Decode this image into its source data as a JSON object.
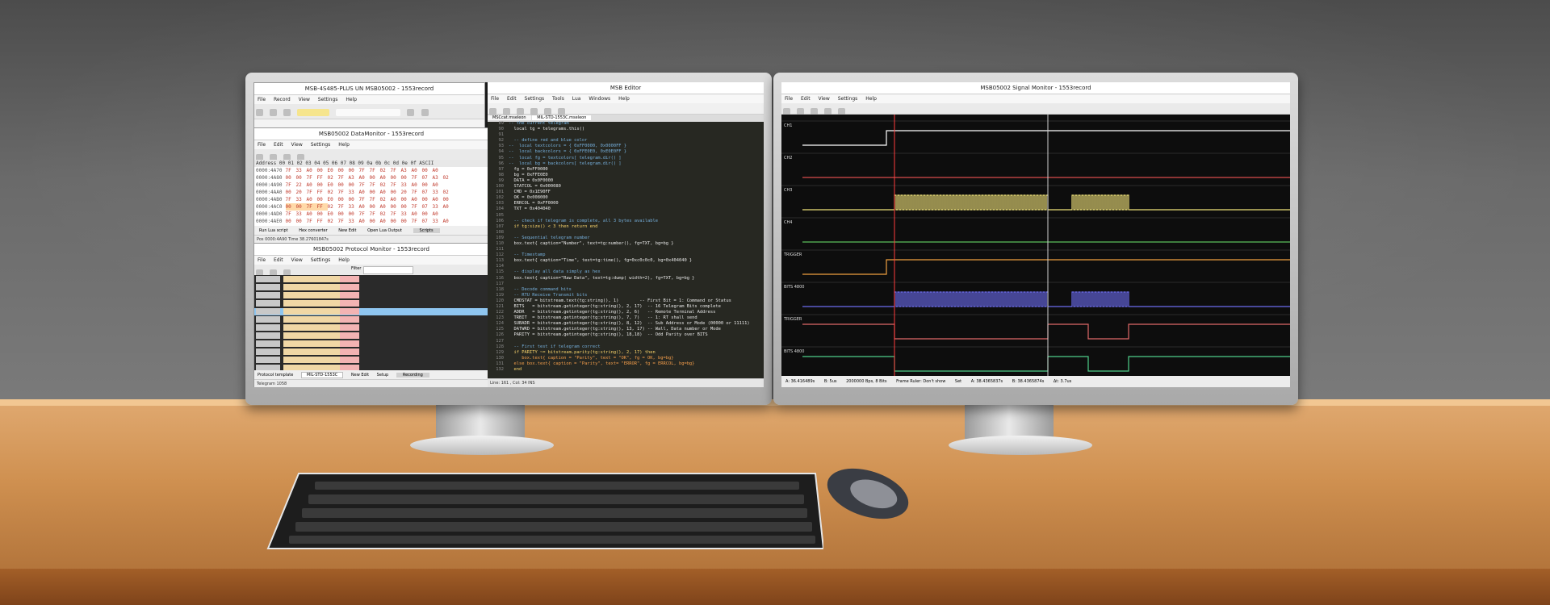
{
  "scene": {
    "wall_color": "#5f5f5f",
    "desk_color": "#d49a5d"
  },
  "left_monitor": {
    "proto_window": {
      "title": "MSB-4S485-PLUS UN MSB05002 - 1553record",
      "menu": [
        "File",
        "Record",
        "View",
        "Settings",
        "Help"
      ]
    },
    "data_window": {
      "title": "MSB05002 DataMonitor - 1553record",
      "menu": [
        "File",
        "Edit",
        "View",
        "Settings",
        "Help"
      ],
      "header": "Address  00 01 02 03 04 05 06 07 08 09 0a 0b 0c 0d 0e 0f ASCII",
      "rows": [
        {
          "addr": "0000:4A70",
          "vals": [
            "7F",
            "33",
            "A0",
            "00",
            "E0",
            "00",
            "00",
            "7F",
            "7F",
            "02",
            "7F",
            "A3",
            "A0",
            "00",
            "A0"
          ]
        },
        {
          "addr": "0000:4A80",
          "vals": [
            "00",
            "00",
            "7F",
            "FF",
            "02",
            "7F",
            "A3",
            "A0",
            "00",
            "A0",
            "00",
            "00",
            "7F",
            "07",
            "A3",
            "02"
          ]
        },
        {
          "addr": "0000:4A90",
          "vals": [
            "7F",
            "22",
            "A0",
            "00",
            "E0",
            "00",
            "00",
            "7F",
            "7F",
            "02",
            "7F",
            "33",
            "A0",
            "00",
            "A0"
          ]
        },
        {
          "addr": "0000:4AA0",
          "vals": [
            "00",
            "20",
            "7F",
            "FF",
            "02",
            "7F",
            "33",
            "A0",
            "00",
            "A0",
            "00",
            "20",
            "7F",
            "07",
            "33",
            "02"
          ]
        },
        {
          "addr": "0000:4AB0",
          "vals": [
            "7F",
            "33",
            "A0",
            "00",
            "E0",
            "00",
            "00",
            "7F",
            "7F",
            "02",
            "A0",
            "00",
            "A0",
            "00",
            "A0",
            "00"
          ]
        },
        {
          "addr": "0000:4AC0",
          "vals": [
            "00",
            "00",
            "7F",
            "FF",
            "02",
            "7F",
            "33",
            "A0",
            "00",
            "A0",
            "00",
            "00",
            "7F",
            "07",
            "33",
            "A0"
          ]
        },
        {
          "addr": "0000:4AD0",
          "vals": [
            "7F",
            "33",
            "A0",
            "00",
            "E0",
            "00",
            "00",
            "7F",
            "7F",
            "02",
            "7F",
            "33",
            "A0",
            "00",
            "A0"
          ]
        },
        {
          "addr": "0000:4AE0",
          "vals": [
            "00",
            "00",
            "7F",
            "FF",
            "02",
            "7F",
            "33",
            "A0",
            "00",
            "A0",
            "00",
            "00",
            "7F",
            "07",
            "33",
            "A0"
          ]
        }
      ],
      "buttons": [
        "Run Lua script",
        "Hex converter",
        "New Edit",
        "Open Lua Output",
        "Scripts"
      ],
      "status": "Pos 0000:4A90 Time 38.27601847s"
    },
    "protocol_window": {
      "title": "MSB05002 Protocol Monitor - 1553record",
      "menu": [
        "File",
        "Edit",
        "View",
        "Settings",
        "Help"
      ],
      "filter_label": "Filter",
      "bottom_label": "Protocol template",
      "template": "MIL-STD-1553C",
      "buttons": [
        "New Edit",
        "Setup",
        "Recording"
      ],
      "status": "Telegram 1058"
    },
    "editor": {
      "title": "MSB Editor",
      "menu": [
        "File",
        "Edit",
        "Settings",
        "Tools",
        "Lua",
        "Windows",
        "Help"
      ],
      "tabs": [
        "MSCcat.mseleon",
        "MIL-STD-1553C.mseleon"
      ],
      "lines": [
        {
          "n": "89",
          "t": "-- the current telegram",
          "c": "cm"
        },
        {
          "n": "90",
          "t": "  local tg = telegrams.this()",
          "c": ""
        },
        {
          "n": "91",
          "t": "",
          "c": ""
        },
        {
          "n": "92",
          "t": "  -- define red and blue color",
          "c": "cm"
        },
        {
          "n": "93",
          "t": "--  local textcolors = { 0xFF0000, 0x0000FF }",
          "c": "cm"
        },
        {
          "n": "94",
          "t": "--  local backcolors = { 0xFFE0E0, 0xE0E0FF }",
          "c": "cm"
        },
        {
          "n": "95",
          "t": "--  local fg = textcolors[ telegram.dir() ]",
          "c": "cm"
        },
        {
          "n": "96",
          "t": "--  local bg = backcolors[ telegram.dir() ]",
          "c": "cm"
        },
        {
          "n": "97",
          "t": "  fg = 0xFF0000",
          "c": ""
        },
        {
          "n": "98",
          "t": "  bg = 0xFFE0E0",
          "c": ""
        },
        {
          "n": "99",
          "t": "  DATA = 0x0F0000",
          "c": ""
        },
        {
          "n": "100",
          "t": "  STATCOL = 0x000080",
          "c": ""
        },
        {
          "n": "101",
          "t": "  CMD = 0x1E90FF",
          "c": ""
        },
        {
          "n": "102",
          "t": "  OK = 0x008000",
          "c": ""
        },
        {
          "n": "103",
          "t": "  ERRCOL = 0xFF0000",
          "c": ""
        },
        {
          "n": "104",
          "t": "  TXT = 0x404040",
          "c": ""
        },
        {
          "n": "105",
          "t": "",
          "c": ""
        },
        {
          "n": "106",
          "t": "  -- check if telegram is complete, all 3 bytes available",
          "c": "cm"
        },
        {
          "n": "107",
          "t": "  if tg:size() < 3 then return end",
          "c": "kw"
        },
        {
          "n": "108",
          "t": "",
          "c": ""
        },
        {
          "n": "109",
          "t": "  -- Sequential telegram number",
          "c": "cm"
        },
        {
          "n": "110",
          "t": "  box.text{ caption=\"Number\", text=tg:number(), fg=TXT, bg=bg }",
          "c": ""
        },
        {
          "n": "111",
          "t": "",
          "c": ""
        },
        {
          "n": "112",
          "t": "  -- Timestamp",
          "c": "cm"
        },
        {
          "n": "113",
          "t": "  box.text{ caption=\"Time\", text=tg:time(), fg=0xc0c0c0, bg=0x404040 }",
          "c": ""
        },
        {
          "n": "114",
          "t": "",
          "c": ""
        },
        {
          "n": "115",
          "t": "  -- display all data simply as hex",
          "c": "cm"
        },
        {
          "n": "116",
          "t": "  box.text{ caption=\"Raw Data\", text=tg:dump( width=2), fg=TXT, bg=bg }",
          "c": ""
        },
        {
          "n": "117",
          "t": "",
          "c": ""
        },
        {
          "n": "118",
          "t": "  -- Decode command bits",
          "c": "cm"
        },
        {
          "n": "119",
          "t": "  -- RTU Receive Transmit bits",
          "c": "cm"
        },
        {
          "n": "120",
          "t": "  CMDSTAT = bitstream.text(tg:string(), 1)        -- First Bit = 1: Command or Status",
          "c": ""
        },
        {
          "n": "121",
          "t": "  BITS   = bitstream.getinteger(tg:string(), 2, 17)  -- 16 Telegram Bits complete",
          "c": ""
        },
        {
          "n": "122",
          "t": "  ADDR   = bitstream.getinteger(tg:string(), 2, 6)   -- Remote Terminal Address",
          "c": ""
        },
        {
          "n": "123",
          "t": "  TRBIT  = bitstream.getinteger(tg:string(), 7, 7)   -- 1: RT shall send",
          "c": ""
        },
        {
          "n": "124",
          "t": "  SUBADR = bitstream.getinteger(tg:string(), 8, 12)  -- Sub Address or Mode (00000 or 11111)",
          "c": ""
        },
        {
          "n": "125",
          "t": "  DATWRD = bitstream.getinteger(tg:string(), 13, 17) -- Wall, Data number or Mode",
          "c": ""
        },
        {
          "n": "126",
          "t": "  PARITY = bitstream.getinteger(tg:string(), 18,18)  -- Odd Parity over BITS",
          "c": ""
        },
        {
          "n": "127",
          "t": "",
          "c": ""
        },
        {
          "n": "128",
          "t": "  -- First test if telegram correct",
          "c": "cm"
        },
        {
          "n": "129",
          "t": "  if PARITY ~= bitstream.parity(tg:string(), 2, 17) then",
          "c": "kw"
        },
        {
          "n": "130",
          "t": "     box.text{ caption = \"Parity\", text = \"OK\", fg = OK, bg=bg}",
          "c": "str"
        },
        {
          "n": "131",
          "t": "  else box.text{ caption = \"Parity\", text= \"ERROR\", fg = ERRCOL, bg=bg}",
          "c": "str"
        },
        {
          "n": "132",
          "t": "  end",
          "c": "kw"
        }
      ],
      "status": "Line: 161 , Col: 34   INS"
    }
  },
  "right_monitor": {
    "title": "MSB05002 Signal Monitor - 1553record",
    "menu": [
      "File",
      "Edit",
      "View",
      "Settings",
      "Help"
    ],
    "trace_labels": [
      "CH1",
      "CH2",
      "CH3",
      "CH4",
      "TRIGGER",
      "BITS 4800",
      "TRIGGER",
      "BITS 4800"
    ],
    "status": [
      "A: 36.416489s",
      "B: 5us",
      "2000000 Bps, 8 Bits",
      "Frame Ruler: Don't show",
      "Set",
      "A: 38.4365837s",
      "B: 38.4365874s",
      "Δt: 3.7us"
    ]
  }
}
